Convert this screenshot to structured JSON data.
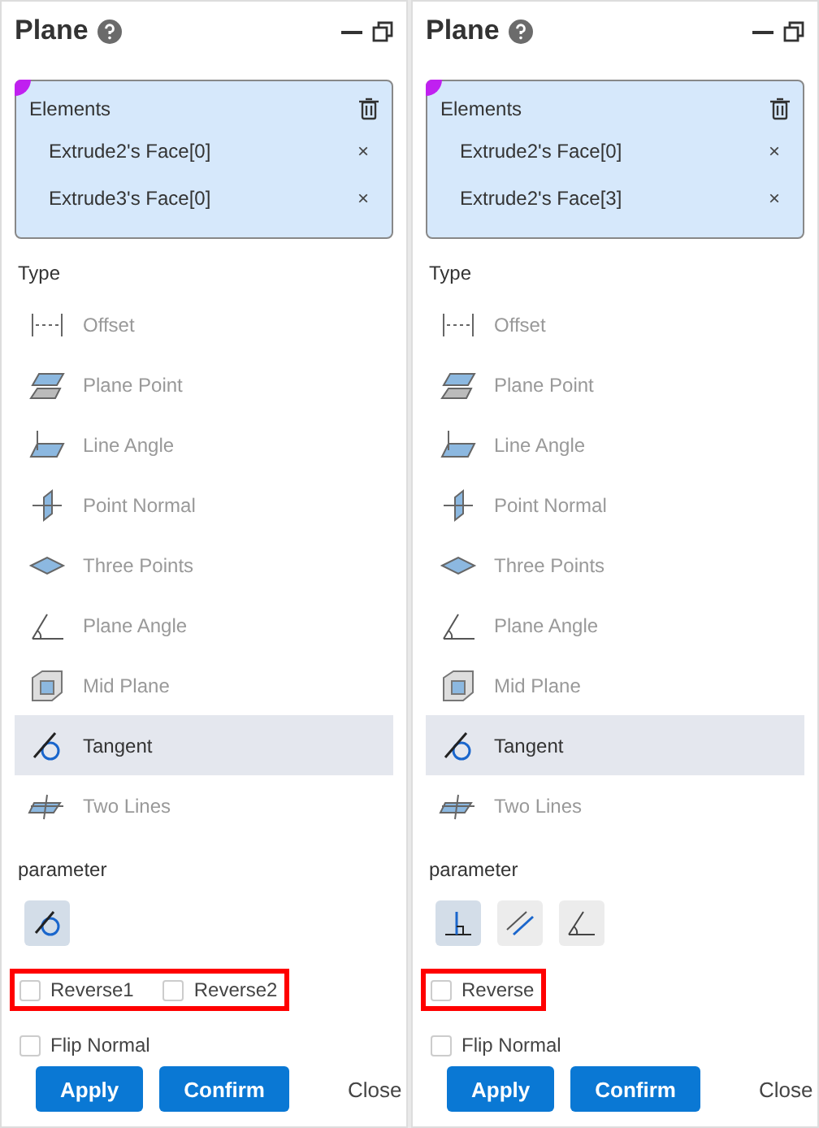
{
  "panels": [
    {
      "title": "Plane",
      "elements": {
        "label": "Elements",
        "items": [
          {
            "name": "Extrude2's Face[0]",
            "remove": "×"
          },
          {
            "name": "Extrude3's Face[0]",
            "remove": "×"
          }
        ]
      },
      "type_label": "Type",
      "types": [
        {
          "kind": "offset",
          "label": "Offset",
          "selected": false
        },
        {
          "kind": "plane-point",
          "label": "Plane Point",
          "selected": false
        },
        {
          "kind": "line-angle",
          "label": "Line Angle",
          "selected": false
        },
        {
          "kind": "point-normal",
          "label": "Point Normal",
          "selected": false
        },
        {
          "kind": "three-points",
          "label": "Three Points",
          "selected": false
        },
        {
          "kind": "plane-angle",
          "label": "Plane Angle",
          "selected": false
        },
        {
          "kind": "mid-plane",
          "label": "Mid Plane",
          "selected": false
        },
        {
          "kind": "tangent",
          "label": "Tangent",
          "selected": true
        },
        {
          "kind": "two-lines",
          "label": "Two Lines",
          "selected": false
        }
      ],
      "parameter_label": "parameter",
      "parameters": [
        {
          "kind": "tangent",
          "selected": true
        }
      ],
      "reverse_options": {
        "highlighted": true,
        "items": [
          {
            "label": "Reverse1",
            "checked": false
          },
          {
            "label": "Reverse2",
            "checked": false
          }
        ]
      },
      "flip_normal": {
        "label": "Flip Normal",
        "checked": false
      },
      "buttons": [
        {
          "kind": "primary",
          "label": "Apply"
        },
        {
          "kind": "primary",
          "label": "Confirm"
        },
        {
          "kind": "plain",
          "label": "Close"
        }
      ]
    },
    {
      "title": "Plane",
      "elements": {
        "label": "Elements",
        "items": [
          {
            "name": "Extrude2's Face[0]",
            "remove": "×"
          },
          {
            "name": "Extrude2's Face[3]",
            "remove": "×"
          }
        ]
      },
      "type_label": "Type",
      "types": [
        {
          "kind": "offset",
          "label": "Offset",
          "selected": false
        },
        {
          "kind": "plane-point",
          "label": "Plane Point",
          "selected": false
        },
        {
          "kind": "line-angle",
          "label": "Line Angle",
          "selected": false
        },
        {
          "kind": "point-normal",
          "label": "Point Normal",
          "selected": false
        },
        {
          "kind": "three-points",
          "label": "Three Points",
          "selected": false
        },
        {
          "kind": "plane-angle",
          "label": "Plane Angle",
          "selected": false
        },
        {
          "kind": "mid-plane",
          "label": "Mid Plane",
          "selected": false
        },
        {
          "kind": "tangent",
          "label": "Tangent",
          "selected": true
        },
        {
          "kind": "two-lines",
          "label": "Two Lines",
          "selected": false
        }
      ],
      "parameter_label": "parameter",
      "parameters": [
        {
          "kind": "perpendicular",
          "selected": true
        },
        {
          "kind": "parallel",
          "selected": false
        },
        {
          "kind": "angle",
          "selected": false
        }
      ],
      "reverse_options": {
        "highlighted": true,
        "items": [
          {
            "label": "Reverse",
            "checked": false
          }
        ]
      },
      "flip_normal": {
        "label": "Flip Normal",
        "checked": false
      },
      "buttons": [
        {
          "kind": "primary",
          "label": "Apply"
        },
        {
          "kind": "primary",
          "label": "Confirm"
        },
        {
          "kind": "plain",
          "label": "Close"
        }
      ]
    }
  ]
}
